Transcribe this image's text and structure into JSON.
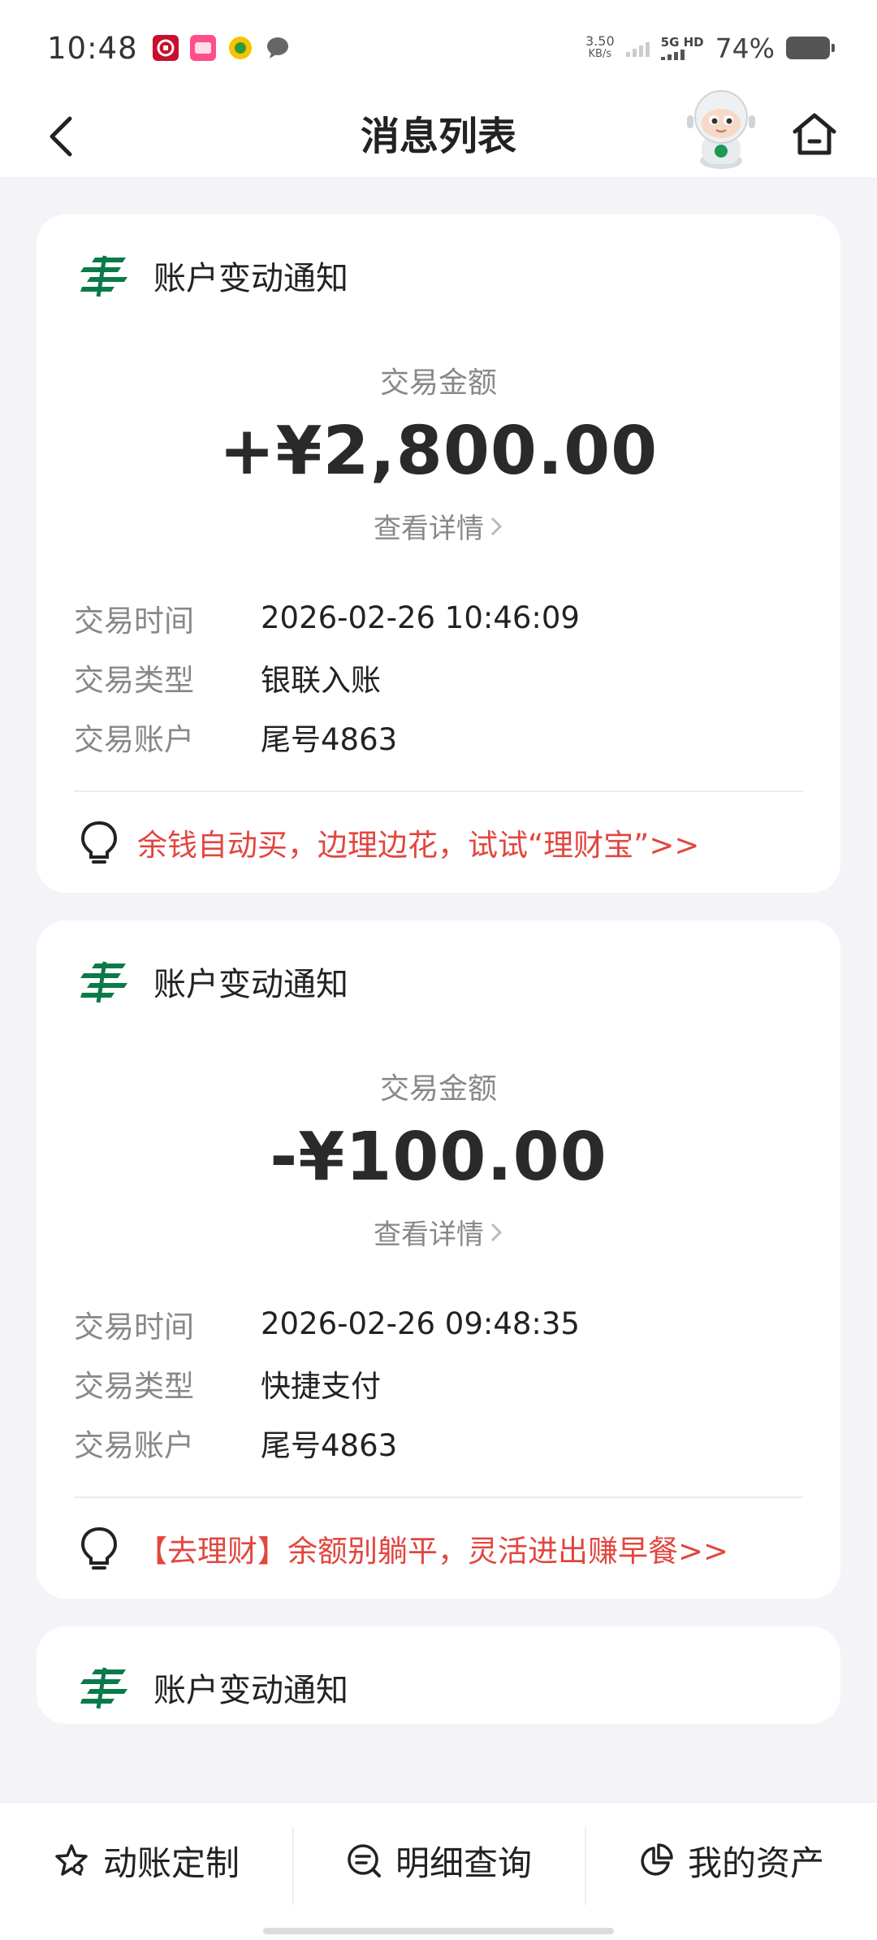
{
  "status_bar": {
    "time": "10:48",
    "net_speed_value": "3.50",
    "net_speed_unit": "KB/s",
    "network": "5G HD",
    "battery": "74%"
  },
  "nav": {
    "title": "消息列表"
  },
  "cards": [
    {
      "title": "账户变动通知",
      "amount_label": "交易金额",
      "amount": "+¥2,800.00",
      "detail_link": "查看详情",
      "rows": [
        {
          "key": "交易时间",
          "value": "2026-02-26 10:46:09"
        },
        {
          "key": "交易类型",
          "value": "银联入账"
        },
        {
          "key": "交易账户",
          "value": "尾号4863"
        }
      ],
      "promo": "余钱自动买，边理边花，试试“理财宝”>>"
    },
    {
      "title": "账户变动通知",
      "amount_label": "交易金额",
      "amount": "-¥100.00",
      "detail_link": "查看详情",
      "rows": [
        {
          "key": "交易时间",
          "value": "2026-02-26 09:48:35"
        },
        {
          "key": "交易类型",
          "value": "快捷支付"
        },
        {
          "key": "交易账户",
          "value": "尾号4863"
        }
      ],
      "promo": "【去理财】余额别躺平，灵活进出赚早餐>>"
    },
    {
      "title": "账户变动通知"
    }
  ],
  "tabs": [
    {
      "label": "动账定制",
      "icon": "star-settings-icon"
    },
    {
      "label": "明细查询",
      "icon": "search-list-icon"
    },
    {
      "label": "我的资产",
      "icon": "pie-chart-icon"
    }
  ],
  "colors": {
    "brand_green": "#0a7a4a",
    "promo_red": "#e2463f",
    "background": "#f4f4f8"
  }
}
